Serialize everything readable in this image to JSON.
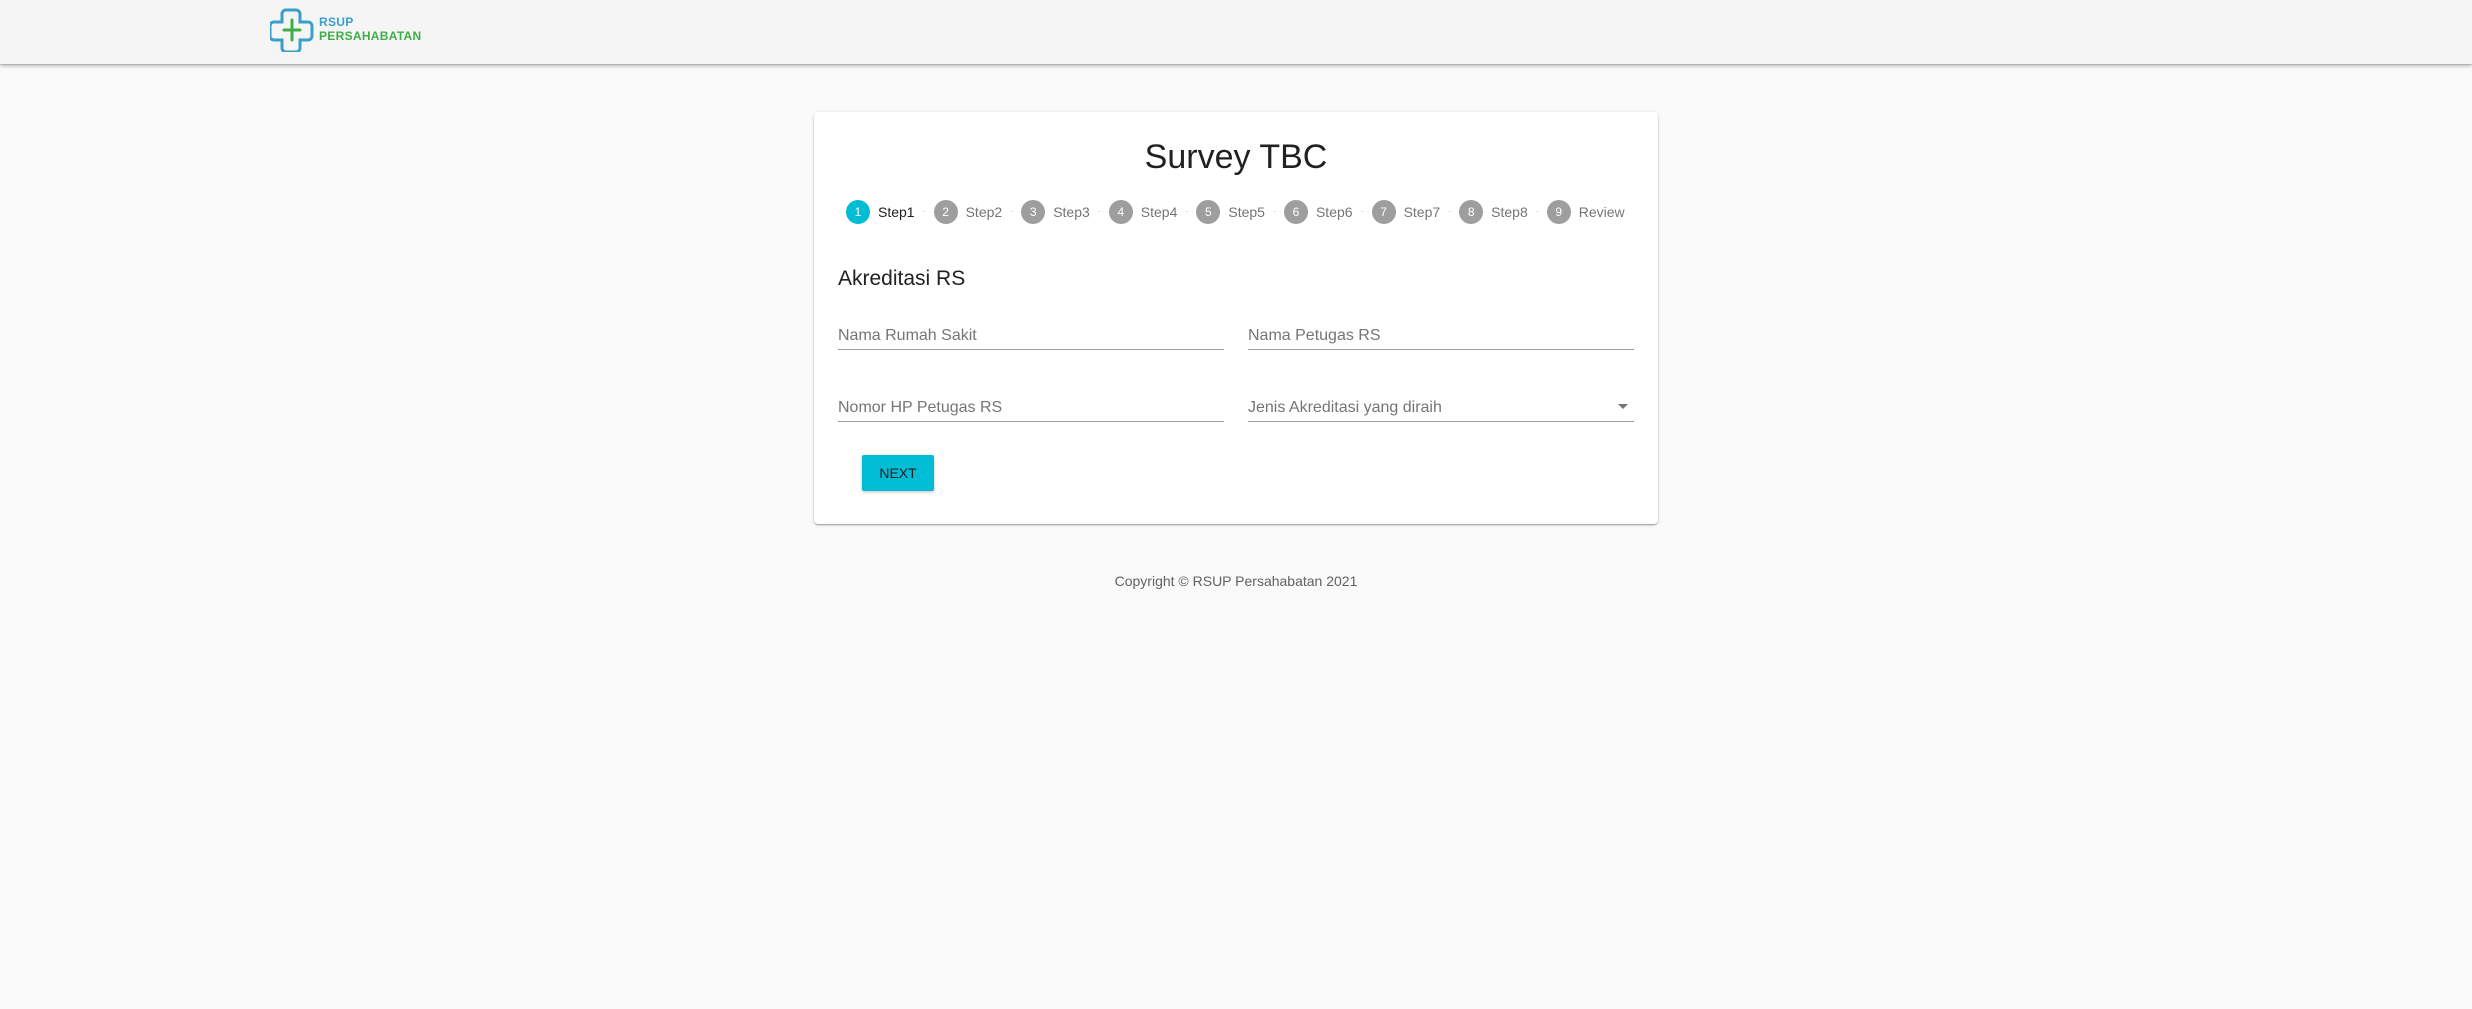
{
  "header": {
    "logo_line1": "RSUP",
    "logo_line2": "PERSAHABATAN"
  },
  "form": {
    "title": "Survey TBC",
    "steps": [
      {
        "number": "1",
        "label": "Step1",
        "active": true
      },
      {
        "number": "2",
        "label": "Step2",
        "active": false
      },
      {
        "number": "3",
        "label": "Step3",
        "active": false
      },
      {
        "number": "4",
        "label": "Step4",
        "active": false
      },
      {
        "number": "5",
        "label": "Step5",
        "active": false
      },
      {
        "number": "6",
        "label": "Step6",
        "active": false
      },
      {
        "number": "7",
        "label": "Step7",
        "active": false
      },
      {
        "number": "8",
        "label": "Step8",
        "active": false
      },
      {
        "number": "9",
        "label": "Review",
        "active": false
      }
    ],
    "step_separator": "·",
    "section_title": "Akreditasi RS",
    "fields": {
      "hospital_name": {
        "placeholder": "Nama Rumah Sakit",
        "value": ""
      },
      "officer_name": {
        "placeholder": "Nama Petugas RS",
        "value": ""
      },
      "officer_phone": {
        "placeholder": "Nomor HP Petugas RS",
        "value": ""
      },
      "accreditation_type": {
        "label": "Jenis Akreditasi yang diraih",
        "value": ""
      }
    },
    "next_label": "NEXT"
  },
  "footer": {
    "copyright": "Copyright © RSUP Persahabatan 2021"
  },
  "colors": {
    "accent": "#00bcd4",
    "inactive_step": "#9e9e9e",
    "appbar": "#f5f5f5",
    "background": "#fafafa",
    "logo_blue": "#3aa0c8",
    "logo_green": "#3fae49"
  }
}
